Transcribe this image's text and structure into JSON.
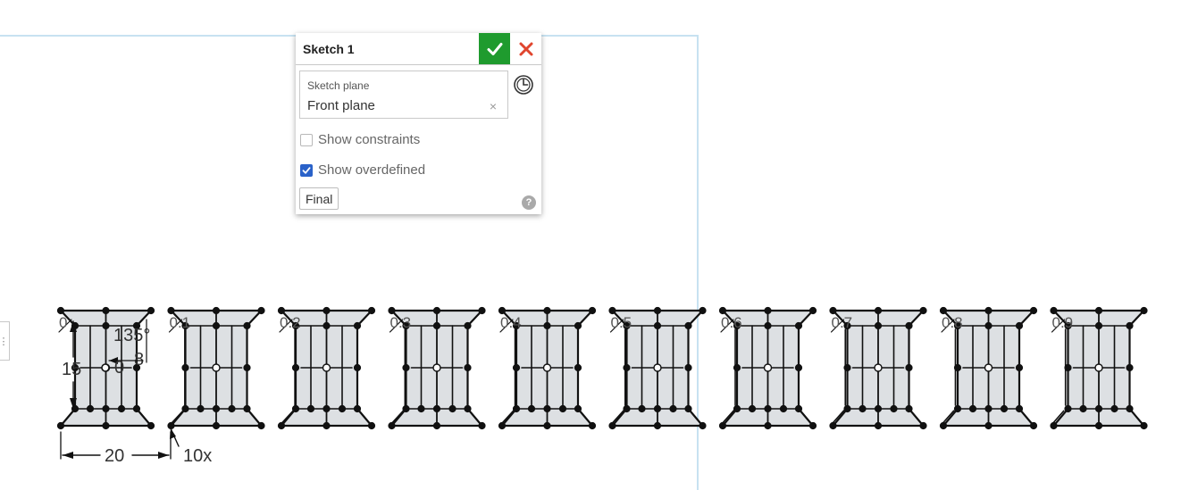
{
  "dialog": {
    "title": "Sketch 1",
    "sketch_plane_label": "Sketch plane",
    "sketch_plane_value": "Front plane",
    "clear_glyph": "×",
    "show_constraints_label": "Show constraints",
    "show_constraints_checked": false,
    "show_overdefined_label": "Show overdefined",
    "show_overdefined_checked": true,
    "final_label": "Final",
    "help_glyph": "?"
  },
  "icons": {
    "accept": "checkmark-icon",
    "cancel": "close-icon",
    "history": "clock-icon",
    "help": "help-icon",
    "side_tab": "grip-icon"
  },
  "colors": {
    "accept_bg": "#1f9b2e",
    "cancel_x": "#e0452e",
    "checkbox_checked": "#2a62c9",
    "plane_frame": "#c7e2f1",
    "profile_fill": "#dde0e3",
    "sketch_line": "#111111"
  },
  "side_tab": {
    "glyph": "⋮"
  },
  "sketch": {
    "instance_labels": [
      "0",
      "0.1",
      "0.2",
      "0.3",
      "0.4",
      "0.5",
      "0.6",
      "0.7",
      "0.8",
      "0.9"
    ],
    "dimensions": {
      "angle": "135°",
      "small": "8",
      "height": "15",
      "center": "0",
      "spacing": "20",
      "pattern_count": "10x"
    }
  }
}
